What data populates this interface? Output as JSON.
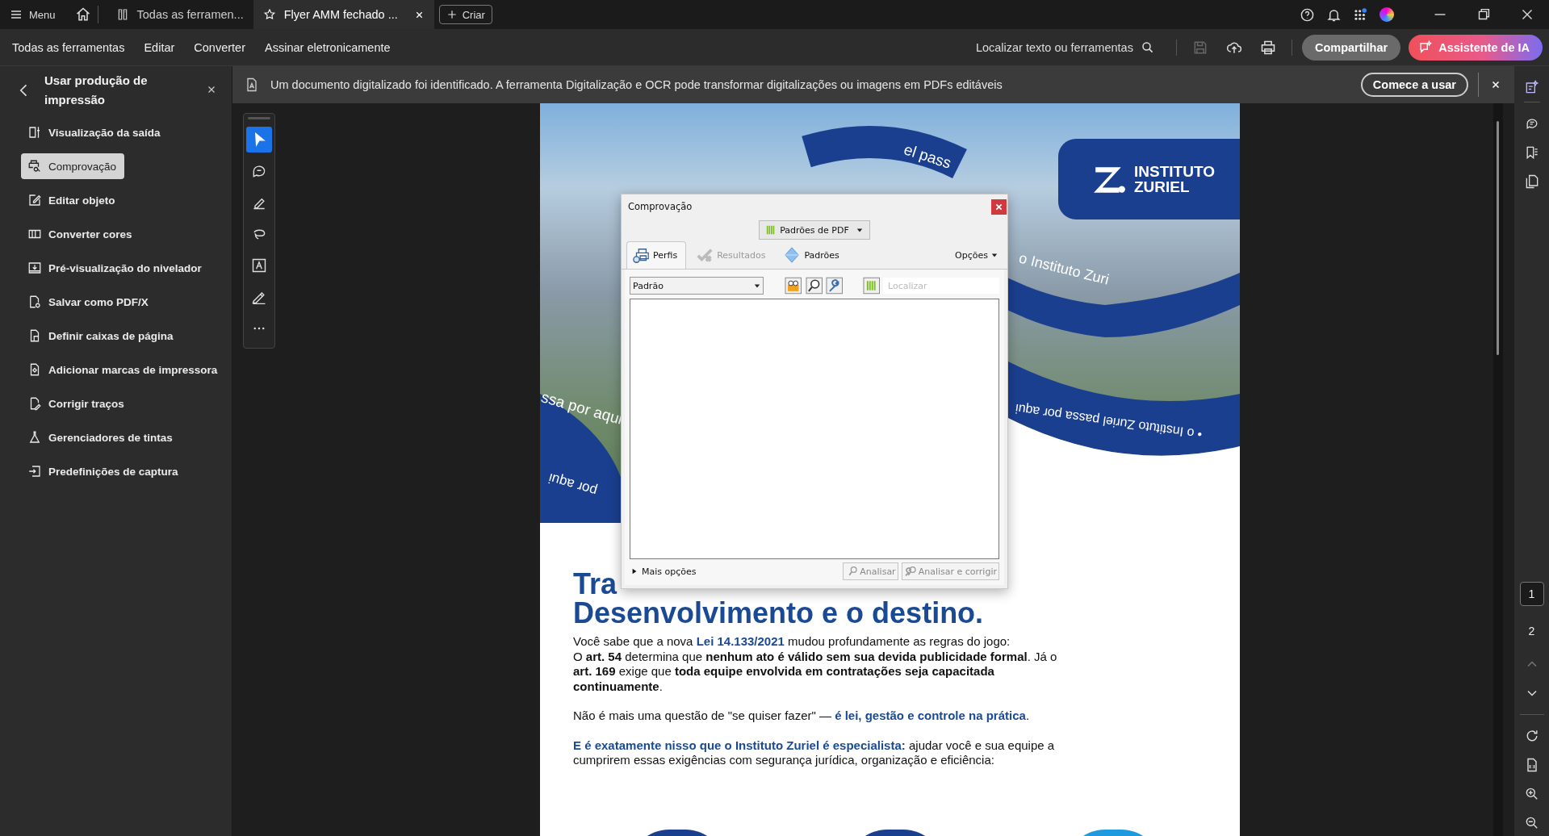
{
  "title_bar": {
    "menu_label": "Menu",
    "tabs": [
      {
        "kind": "tools",
        "label": "Todas as ferramen...",
        "selected": false
      },
      {
        "kind": "document",
        "label": "Flyer AMM fechado ...",
        "selected": true
      }
    ],
    "create_button": "Criar"
  },
  "menu_bar": {
    "items": [
      "Todas as ferramentas",
      "Editar",
      "Converter",
      "Assinar eletronicamente"
    ],
    "search_label": "Localizar texto ou ferramentas",
    "actions": [
      {
        "kind": "save",
        "disabled": true
      },
      {
        "kind": "upload",
        "disabled": false
      },
      {
        "kind": "print",
        "disabled": false
      }
    ],
    "share_button": "Compartilhar",
    "ai_button": "Assistente de IA"
  },
  "left_panel": {
    "title": "Usar produção de impressão",
    "items": [
      {
        "kind": "output",
        "label": "Visualização da saída",
        "selected": false
      },
      {
        "kind": "preflight",
        "label": "Comprovação",
        "selected": true
      },
      {
        "kind": "edit",
        "label": "Editar objeto",
        "selected": false
      },
      {
        "kind": "colors",
        "label": "Converter cores",
        "selected": false
      },
      {
        "kind": "flatten",
        "label": "Pré-visualização do nivelador",
        "selected": false
      },
      {
        "kind": "pdfx",
        "label": "Salvar como PDF/X",
        "selected": false
      },
      {
        "kind": "boxes",
        "label": "Definir caixas de página",
        "selected": false
      },
      {
        "kind": "marks",
        "label": "Adicionar marcas de impressora",
        "selected": false
      },
      {
        "kind": "strokes",
        "label": "Corrigir traços",
        "selected": false
      },
      {
        "kind": "ink",
        "label": "Gerenciadores de tintas",
        "selected": false
      },
      {
        "kind": "capture",
        "label": "Predefinições de captura",
        "selected": false
      }
    ]
  },
  "banner": {
    "text": "Um documento digitalizado foi identificado. A ferramenta Digitalização e OCR pode transformar digitalizações ou imagens em PDFs editáveis",
    "button": "Comece a usar"
  },
  "tool_strip": [
    {
      "kind": "select",
      "selected": true
    },
    {
      "kind": "comment",
      "selected": false
    },
    {
      "kind": "pen",
      "selected": false
    },
    {
      "kind": "lasso",
      "selected": false
    },
    {
      "kind": "textbox",
      "selected": false
    },
    {
      "kind": "sign",
      "selected": false
    },
    {
      "kind": "more",
      "selected": false
    }
  ],
  "document": {
    "logo": [
      "INSTITUTO",
      "ZURIEL"
    ],
    "band_texts": [
      "el pass",
      "o Instituto Zuri",
      "ssa por aqui",
      "• o Instituto Zuriel passa por aqui",
      "por aqui"
    ],
    "headline": [
      "Tra",
      "Desenvolvimento e o destino."
    ],
    "paragraphs": [
      {
        "lines": [
          [
            {
              "kind": "plain",
              "text": "Você sabe que a nova "
            },
            {
              "kind": "accent",
              "text": "Lei 14.133/2021"
            },
            {
              "kind": "plain",
              "text": " mudou profundamente as regras do jogo:"
            }
          ],
          [
            {
              "kind": "plain",
              "text": "O "
            },
            {
              "kind": "bold",
              "text": "art. 54"
            },
            {
              "kind": "plain",
              "text": " determina que "
            },
            {
              "kind": "bold",
              "text": "nenhum ato é válido sem sua devida publicidade formal"
            },
            {
              "kind": "plain",
              "text": ". Já o "
            },
            {
              "kind": "bold",
              "text": "art. 169"
            },
            {
              "kind": "plain",
              "text": " exige que "
            },
            {
              "kind": "bold",
              "text": "toda equipe envolvida em contratações seja capacitada continuamente"
            },
            {
              "kind": "plain",
              "text": "."
            }
          ]
        ]
      },
      {
        "lines": [
          [
            {
              "kind": "plain",
              "text": "Não é mais uma questão de \"se quiser fazer\" — "
            },
            {
              "kind": "accent",
              "text": "é lei, gestão e controle na prática"
            },
            {
              "kind": "plain",
              "text": "."
            }
          ]
        ]
      },
      {
        "lines": [
          [
            {
              "kind": "accent",
              "text": "E é exatamente nisso que o Instituto Zuriel é especialista:"
            },
            {
              "kind": "plain",
              "text": " ajudar você e sua equipe a cumprirem essas exigências com segurança jurídica, organização e eficiência:"
            }
          ]
        ]
      }
    ]
  },
  "dialog": {
    "title": "Comprovação",
    "profile_button": "Padrões de PDF",
    "tabs": [
      {
        "kind": "profiles",
        "label": "Perfis",
        "selected": true,
        "disabled": false
      },
      {
        "kind": "results",
        "label": "Resultados",
        "selected": false,
        "disabled": true
      },
      {
        "kind": "standards",
        "label": "Padrões",
        "selected": false,
        "disabled": false
      }
    ],
    "options": "Opções",
    "select_value": "Padrão",
    "search_placeholder": "Localizar",
    "more_options": "Mais opções",
    "buttons": [
      {
        "kind": "analyze",
        "label": "Analisar",
        "disabled": true
      },
      {
        "kind": "fix",
        "label": "Analisar e corrigir",
        "disabled": true
      }
    ]
  },
  "right_rail": {
    "pages": [
      {
        "label": "1",
        "selected": true
      },
      {
        "label": "2",
        "selected": false
      }
    ]
  }
}
